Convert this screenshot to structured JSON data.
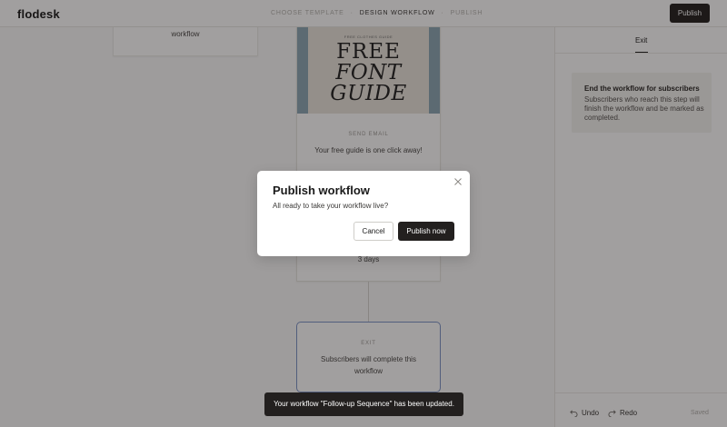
{
  "header": {
    "logo": "flodesk",
    "steps": [
      "CHOOSE TEMPLATE",
      "DESIGN WORKFLOW",
      "PUBLISH"
    ],
    "step_separator": "·",
    "active_step_index": 1,
    "publish_label": "Publish"
  },
  "canvas": {
    "left_card_text": "workflow",
    "email_card": {
      "thumbnail": {
        "small_text": "FREE CLOTHES GUIDE",
        "line1": "FREE",
        "line2": "FONT",
        "line3": "GUIDE"
      },
      "label": "SEND EMAIL",
      "subject": "Your free guide is one click away!",
      "delay": "3 days"
    },
    "exit_card": {
      "label": "EXIT",
      "description": "Subscribers will complete this workflow"
    }
  },
  "panel": {
    "tab": "Exit",
    "info_title": "End the workflow for subscribers",
    "info_text": "Subscribers who reach this step will finish the workflow and be marked as completed.",
    "undo": "Undo",
    "redo": "Redo",
    "saved": "Saved"
  },
  "modal": {
    "title": "Publish workflow",
    "subtitle": "All ready to take your workflow live?",
    "cancel": "Cancel",
    "confirm": "Publish now"
  },
  "toast": {
    "message": "Your workflow \"Follow-up Sequence\" has been updated."
  },
  "colors": {
    "primary_button": "#23201f",
    "overlay": "rgba(20,16,14,0.40)",
    "exit_card_border": "#7c93c6",
    "thumbnail_frame": "#8ca7b5"
  }
}
